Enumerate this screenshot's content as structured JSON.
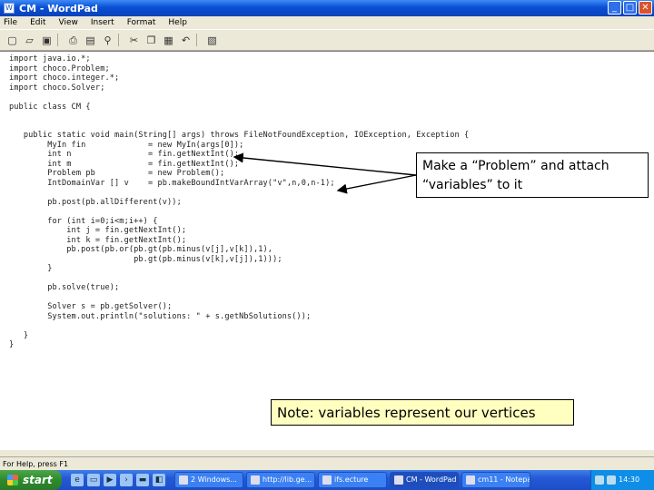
{
  "window": {
    "title": "CM - WordPad",
    "app_icon": "wordpad-icon",
    "buttons": {
      "minimize": "_",
      "maximize": "□",
      "close": "✕"
    }
  },
  "menu": [
    "File",
    "Edit",
    "View",
    "Insert",
    "Format",
    "Help"
  ],
  "toolbar_icons": [
    "new-icon",
    "open-icon",
    "save-icon",
    "print-icon",
    "print-preview-icon",
    "find-icon",
    "cut-icon",
    "copy-icon",
    "paste-icon",
    "undo-icon",
    "insert-date-icon"
  ],
  "code": [
    "import java.io.*;",
    "import choco.Problem;",
    "import choco.integer.*;",
    "import choco.Solver;",
    "",
    "public class CM {",
    "",
    "",
    "   public static void main(String[] args) throws FileNotFoundException, IOException, Exception {",
    "        MyIn fin             = new MyIn(args[0]);",
    "        int n                = fin.getNextInt();",
    "        int m                = fin.getNextInt();",
    "        Problem pb           = new Problem();",
    "        IntDomainVar [] v    = pb.makeBoundIntVarArray(\"v\",n,0,n-1);",
    "",
    "        pb.post(pb.allDifferent(v));",
    "",
    "        for (int i=0;i<m;i++) {",
    "            int j = fin.getNextInt();",
    "            int k = fin.getNextInt();",
    "            pb.post(pb.or(pb.gt(pb.minus(v[j],v[k]),1),",
    "                          pb.gt(pb.minus(v[k],v[j]),1)));",
    "        }",
    "",
    "        pb.solve(true);",
    "",
    "        Solver s = pb.getSolver();",
    "        System.out.println(\"solutions: \" + s.getNbSolutions());",
    "",
    "   }",
    "}"
  ],
  "callout": {
    "text": "Make a “Problem” and attach “variables” to it"
  },
  "note": {
    "text": "Note: variables represent our vertices"
  },
  "status": {
    "text": "For Help, press F1"
  },
  "taskbar": {
    "start_label": "start",
    "quick_launch": [
      "ie-icon",
      "desktop-icon",
      "media-icon",
      "cmd-icon",
      "folder-icon",
      "explorer-icon"
    ],
    "tasks": [
      {
        "label": "2 Windows...",
        "icon": "folder-icon"
      },
      {
        "label": "http://lib.ge...",
        "icon": "ie-icon"
      },
      {
        "label": "ifs.ecture",
        "icon": "document-icon"
      },
      {
        "label": "CM - WordPad",
        "icon": "wordpad-icon"
      },
      {
        "label": "cm11 - Notepad",
        "icon": "notepad-icon"
      }
    ],
    "clock": "14:30"
  }
}
